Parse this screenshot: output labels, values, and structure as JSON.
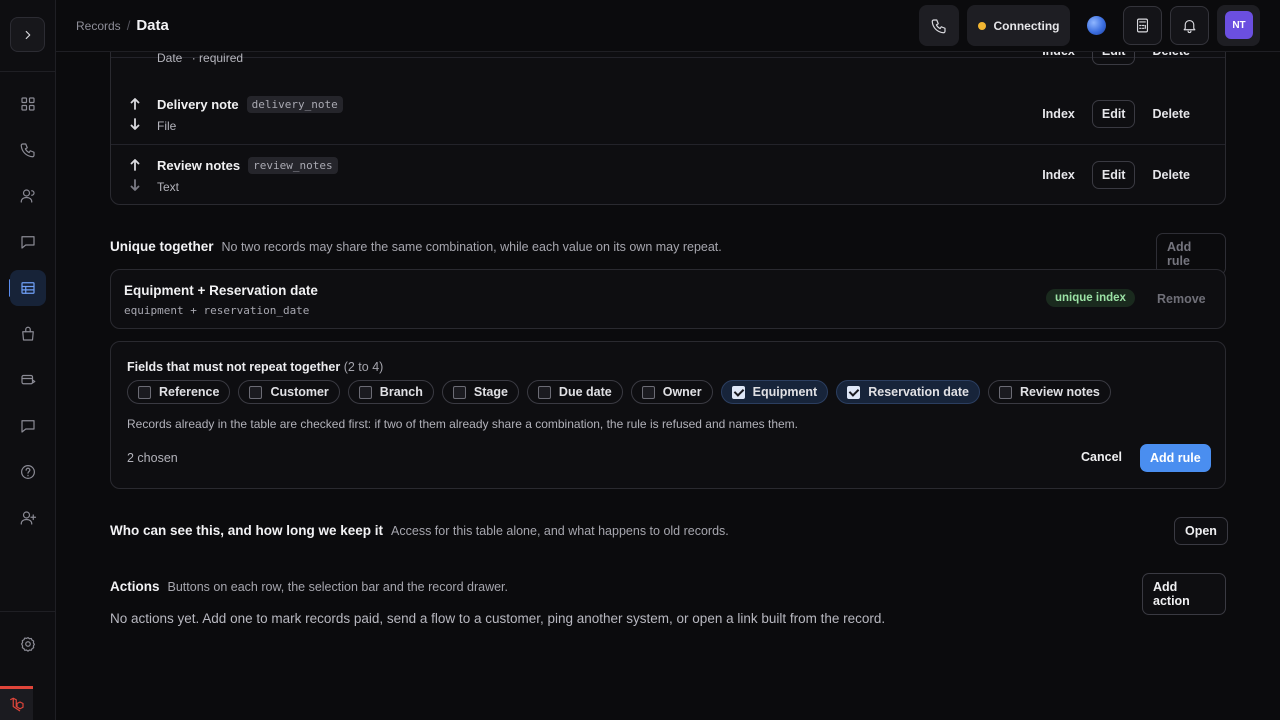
{
  "header": {
    "breadcrumb_parent": "Records",
    "breadcrumb_separator": "/",
    "breadcrumb_current": "Data",
    "status_text": "Connecting",
    "status_color": "#f2b632",
    "avatar_initials": "NT"
  },
  "sidebar": {
    "items": [
      "grid-icon",
      "phone-icon",
      "users-icon",
      "chat-icon",
      "table-icon",
      "bag-icon",
      "card-icon",
      "message-icon",
      "help-icon",
      "user-plus-icon"
    ],
    "active": "table-icon",
    "bottom_items": [
      "settings-icon"
    ]
  },
  "fields": [
    {
      "label": "",
      "key": "",
      "type": "Date",
      "required": "· required"
    },
    {
      "label": "Delivery note",
      "key": "delivery_note",
      "type": "File"
    },
    {
      "label": "Review notes",
      "key": "review_notes",
      "type": "Text"
    }
  ],
  "row_actions": {
    "index": "Index",
    "edit": "Edit",
    "delete": "Delete"
  },
  "unique": {
    "title": "Unique together",
    "description": "No two records may share the same combination, while each value on its own may repeat.",
    "add_rule": "Add rule",
    "rule": {
      "title": "Equipment + Reservation date",
      "key": "equipment + reservation_date",
      "badge": "unique index",
      "remove": "Remove"
    },
    "form": {
      "label": "Fields that must not repeat together",
      "hint": "(2 to 4)",
      "chips": [
        {
          "label": "Reference",
          "checked": false
        },
        {
          "label": "Customer",
          "checked": false
        },
        {
          "label": "Branch",
          "checked": false
        },
        {
          "label": "Stage",
          "checked": false
        },
        {
          "label": "Due date",
          "checked": false
        },
        {
          "label": "Owner",
          "checked": false
        },
        {
          "label": "Equipment",
          "checked": true
        },
        {
          "label": "Reservation date",
          "checked": true
        },
        {
          "label": "Review notes",
          "checked": false
        }
      ],
      "note": "Records already in the table are checked first: if two of them already share a combination, the rule is refused and names them.",
      "chosen": "2 chosen",
      "cancel": "Cancel",
      "submit": "Add rule"
    }
  },
  "access": {
    "title": "Who can see this, and how long we keep it",
    "description": "Access for this table alone, and what happens to old records.",
    "button": "Open"
  },
  "actions": {
    "title": "Actions",
    "description": "Buttons on each row, the selection bar and the record drawer.",
    "button": "Add action",
    "empty": "No actions yet. Add one to mark records paid, send a flow to a customer, ping another system, or open a link built from the record."
  }
}
